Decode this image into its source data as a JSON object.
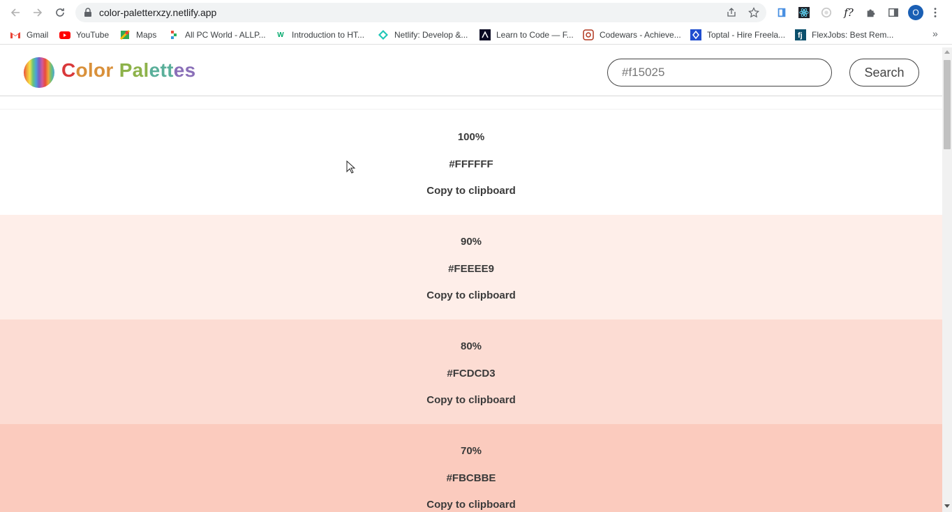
{
  "browser": {
    "url": "color-paletterxzy.netlify.app",
    "profile_initial": "O",
    "bookmarks": [
      {
        "label": "Gmail",
        "icon": "gmail-icon"
      },
      {
        "label": "YouTube",
        "icon": "youtube-icon"
      },
      {
        "label": "Maps",
        "icon": "maps-icon"
      },
      {
        "label": "All PC World - ALLP...",
        "icon": "allpcworld-icon"
      },
      {
        "label": "Introduction to HT...",
        "icon": "w3-icon"
      },
      {
        "label": "Netlify: Develop &...",
        "icon": "netlify-icon"
      },
      {
        "label": "Learn to Code — F...",
        "icon": "fcc-icon"
      },
      {
        "label": "Codewars - Achieve...",
        "icon": "codewars-icon"
      },
      {
        "label": "Toptal - Hire Freela...",
        "icon": "toptal-icon"
      },
      {
        "label": "FlexJobs: Best Rem...",
        "icon": "flexjobs-icon"
      }
    ],
    "more_bookmarks": "»"
  },
  "site": {
    "logo_parts": [
      "C",
      "olor",
      " Pal",
      "ett",
      "es"
    ],
    "search": {
      "value": "#f15025"
    },
    "search_button": "Search"
  },
  "swatches": [
    {
      "percent": "100%",
      "hex": "#FFFFFF",
      "bg": "#FFFFFF",
      "copy": "Copy to clipboard"
    },
    {
      "percent": "90%",
      "hex": "#FEEEE9",
      "bg": "#FEEEE9",
      "copy": "Copy to clipboard"
    },
    {
      "percent": "80%",
      "hex": "#FCDCD3",
      "bg": "#FCDCD3",
      "copy": "Copy to clipboard"
    },
    {
      "percent": "70%",
      "hex": "#FBCBBE",
      "bg": "#FBCBBE",
      "copy": "Copy to clipboard"
    }
  ]
}
